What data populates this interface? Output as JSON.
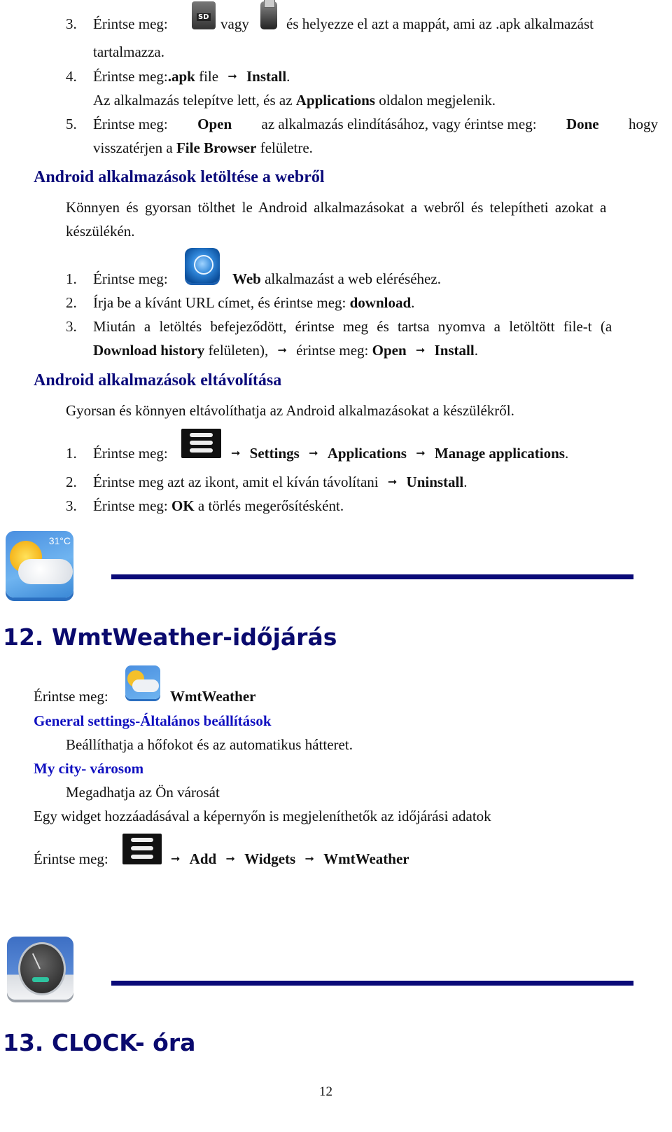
{
  "steps_top": {
    "s3_num": "3.",
    "s3_a": "Érintse meg:",
    "s3_b": "vagy",
    "s3_c": "és helyezze el azt a mappát, ami az .apk alkalmazást",
    "s3_cont": "tartalmazza.",
    "s4_num": "4.",
    "s4_a": "Érintse meg:",
    "s4_apk": ".apk",
    "s4_file": "file",
    "s4_install": "Install",
    "s4_period": ".",
    "s4_note_a": "Az alkalmazás telepítve lett, és az",
    "s4_note_apps": "Applications",
    "s4_note_b": "oldalon megjelenik.",
    "s5_num": "5.",
    "s5_a": "Érintse meg:",
    "s5_open": "Open",
    "s5_b": "az alkalmazás elindításához, vagy érintse meg:",
    "s5_done": "Done",
    "s5_c": "hogy",
    "s5_cont_a": "visszatérjen a",
    "s5_cont_fb": "File Browser",
    "s5_cont_b": "felületre."
  },
  "download": {
    "heading": "Android alkalmazások letöltése a webről",
    "intro_line1": "Könnyen és gyorsan tölthet le Android alkalmazásokat a webről és telepítheti azokat a",
    "intro_line2": "készülékén.",
    "s1_num": "1.",
    "s1_a": "Érintse meg:",
    "s1_web": "Web",
    "s1_b": "alkalmazást a web eléréséhez.",
    "s2_num": "2.",
    "s2_a": "Írja be a kívánt URL címet, és érintse meg:",
    "s2_dl": "download",
    "s2_period": ".",
    "s3_num": "3.",
    "s3_line1": "Miután a letöltés befejeződött, érintse meg és tartsa nyomva a letöltött file-t (a",
    "s3_dh": "Download history",
    "s3_b": "felületen),",
    "s3_c": "érintse meg:",
    "s3_open": "Open",
    "s3_install": "Install",
    "s3_period": "."
  },
  "uninstall": {
    "heading": "Android alkalmazások eltávolítása",
    "intro": "Gyorsan és könnyen eltávolíthatja az Android alkalmazásokat a készülékről.",
    "s1_num": "1.",
    "s1_a": "Érintse meg:",
    "s1_settings": "Settings",
    "s1_apps": "Applications",
    "s1_manage": "Manage applications",
    "s1_period": ".",
    "s2_num": "2.",
    "s2_a": "Érintse meg azt az ikont, amit el kíván távolítani",
    "s2_uninstall": "Uninstall",
    "s2_period": ".",
    "s3_num": "3.",
    "s3_a": "Érintse meg:",
    "s3_ok": "OK",
    "s3_b": "a törlés megerősítésként."
  },
  "weather": {
    "icon_temp": "31°C",
    "heading": "12. WmtWeather-időjárás",
    "touch_a": "Érintse meg:",
    "touch_app": "WmtWeather",
    "general_heading": "General settings-Általános beállítások",
    "general_text": "Beállíthatja a hőfokot és az automatikus hátteret.",
    "city_heading": "My city- városom",
    "city_text": "Megadhatja az Ön városát",
    "widget_text": "Egy widget hozzáadásával a képernyőn is megjeleníthetők az időjárási adatok",
    "widget_a": "Érintse meg:",
    "widget_add": "Add",
    "widget_widgets": "Widgets",
    "widget_app": "WmtWeather"
  },
  "clock": {
    "heading": "13. CLOCK- óra"
  },
  "arrow_glyph": "➞",
  "page_number": "12",
  "colors": {
    "heading": "#0a0a7a",
    "subheading": "#1010c0",
    "rule": "#0a0a78"
  }
}
